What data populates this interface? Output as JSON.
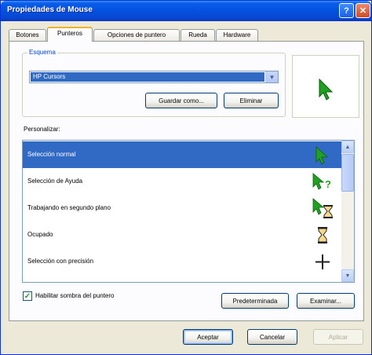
{
  "window": {
    "title": "Propiedades de Mouse",
    "help_glyph": "?",
    "close_glyph": "✕"
  },
  "tabs": [
    {
      "label": "Botones",
      "active": false
    },
    {
      "label": "Punteros",
      "active": true
    },
    {
      "label": "Opciones de puntero",
      "active": false
    },
    {
      "label": "Rueda",
      "active": false
    },
    {
      "label": "Hardware",
      "active": false
    }
  ],
  "scheme": {
    "legend": "Esquema",
    "selected": "HP Cursors",
    "save_as_label": "Guardar como...",
    "delete_label": "Eliminar"
  },
  "preview": {
    "icon": "normal-select-cursor-icon"
  },
  "customize": {
    "label": "Personalizar:",
    "rows": [
      {
        "label": "Selección normal",
        "icon": "normal-select-cursor-icon",
        "selected": true
      },
      {
        "label": "Selección de Ayuda",
        "icon": "help-select-cursor-icon",
        "selected": false
      },
      {
        "label": "Trabajando en segundo plano",
        "icon": "working-in-background-cursor-icon",
        "selected": false
      },
      {
        "label": "Ocupado",
        "icon": "busy-hourglass-cursor-icon",
        "selected": false
      },
      {
        "label": "Selección con precisión",
        "icon": "precision-select-cursor-icon",
        "selected": false
      }
    ]
  },
  "shadow_checkbox": {
    "label": "Habilitar sombra del puntero",
    "checked": true
  },
  "buttons": {
    "default_label": "Predeterminada",
    "browse_label": "Examinar...",
    "ok_label": "Aceptar",
    "cancel_label": "Cancelar",
    "apply_label": "Aplicar"
  },
  "colors": {
    "title_blue": "#0554e3",
    "selection_blue": "#316ac5",
    "cursor_green": "#21a121",
    "face": "#ece9d8"
  }
}
